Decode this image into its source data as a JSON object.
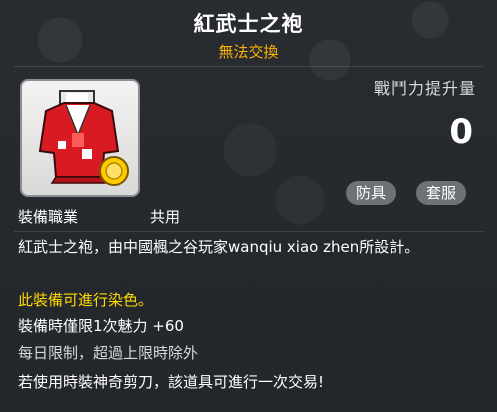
{
  "item": {
    "name": "紅武士之袍",
    "trade_status": "無法交換",
    "power_label": "戰鬥力提升量",
    "power_value": "0",
    "tags": [
      "防具",
      "套服"
    ],
    "job_label": "裝備職業",
    "job_value": "共用",
    "description": "紅武士之袍，由中國楓之谷玩家wanqiu xiao zhen所設計。",
    "dye_note": "此裝備可進行染色。",
    "limit_note": "裝備時僅限1次魅力 +60",
    "daily_note": "每日限制，超過上限時除外",
    "trade_note": "若使用時裝神奇剪刀，該道具可進行一次交易!"
  },
  "colors": {
    "title": "#ffffff",
    "trade_status": "#ffb300",
    "dye_note": "#ffd800",
    "tag_bg": "#6e7276"
  },
  "icons": {
    "item": "red-robe-icon"
  }
}
